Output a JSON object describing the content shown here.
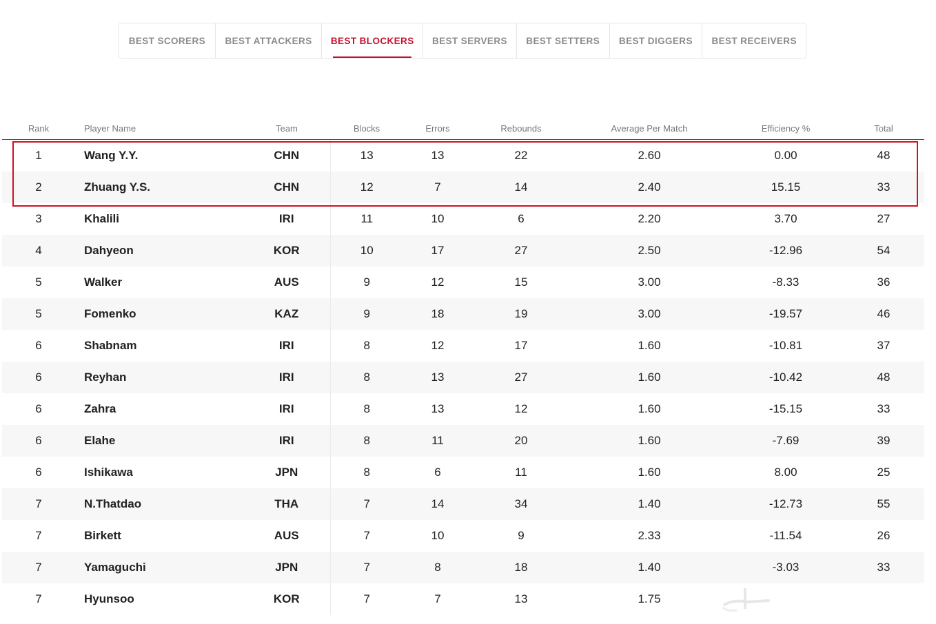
{
  "tabs": [
    {
      "label": "BEST SCORERS",
      "active": false
    },
    {
      "label": "BEST ATTACKERS",
      "active": false
    },
    {
      "label": "BEST BLOCKERS",
      "active": true
    },
    {
      "label": "BEST SERVERS",
      "active": false
    },
    {
      "label": "BEST SETTERS",
      "active": false
    },
    {
      "label": "BEST DIGGERS",
      "active": false
    },
    {
      "label": "BEST RECEIVERS",
      "active": false
    }
  ],
  "table": {
    "headers": {
      "rank": "Rank",
      "player": "Player Name",
      "team": "Team",
      "blocks": "Blocks",
      "errors": "Errors",
      "rebounds": "Rebounds",
      "avg": "Average Per Match",
      "efficiency": "Efficiency %",
      "total": "Total"
    },
    "rows": [
      {
        "rank": "1",
        "player": "Wang Y.Y.",
        "team": "CHN",
        "blocks": "13",
        "errors": "13",
        "rebounds": "22",
        "avg": "2.60",
        "efficiency": "0.00",
        "total": "48"
      },
      {
        "rank": "2",
        "player": "Zhuang Y.S.",
        "team": "CHN",
        "blocks": "12",
        "errors": "7",
        "rebounds": "14",
        "avg": "2.40",
        "efficiency": "15.15",
        "total": "33"
      },
      {
        "rank": "3",
        "player": "Khalili",
        "team": "IRI",
        "blocks": "11",
        "errors": "10",
        "rebounds": "6",
        "avg": "2.20",
        "efficiency": "3.70",
        "total": "27"
      },
      {
        "rank": "4",
        "player": "Dahyeon",
        "team": "KOR",
        "blocks": "10",
        "errors": "17",
        "rebounds": "27",
        "avg": "2.50",
        "efficiency": "-12.96",
        "total": "54"
      },
      {
        "rank": "5",
        "player": "Walker",
        "team": "AUS",
        "blocks": "9",
        "errors": "12",
        "rebounds": "15",
        "avg": "3.00",
        "efficiency": "-8.33",
        "total": "36"
      },
      {
        "rank": "5",
        "player": "Fomenko",
        "team": "KAZ",
        "blocks": "9",
        "errors": "18",
        "rebounds": "19",
        "avg": "3.00",
        "efficiency": "-19.57",
        "total": "46"
      },
      {
        "rank": "6",
        "player": "Shabnam",
        "team": "IRI",
        "blocks": "8",
        "errors": "12",
        "rebounds": "17",
        "avg": "1.60",
        "efficiency": "-10.81",
        "total": "37"
      },
      {
        "rank": "6",
        "player": "Reyhan",
        "team": "IRI",
        "blocks": "8",
        "errors": "13",
        "rebounds": "27",
        "avg": "1.60",
        "efficiency": "-10.42",
        "total": "48"
      },
      {
        "rank": "6",
        "player": "Zahra",
        "team": "IRI",
        "blocks": "8",
        "errors": "13",
        "rebounds": "12",
        "avg": "1.60",
        "efficiency": "-15.15",
        "total": "33"
      },
      {
        "rank": "6",
        "player": "Elahe",
        "team": "IRI",
        "blocks": "8",
        "errors": "11",
        "rebounds": "20",
        "avg": "1.60",
        "efficiency": "-7.69",
        "total": "39"
      },
      {
        "rank": "6",
        "player": "Ishikawa",
        "team": "JPN",
        "blocks": "8",
        "errors": "6",
        "rebounds": "11",
        "avg": "1.60",
        "efficiency": "8.00",
        "total": "25"
      },
      {
        "rank": "7",
        "player": "N.Thatdao",
        "team": "THA",
        "blocks": "7",
        "errors": "14",
        "rebounds": "34",
        "avg": "1.40",
        "efficiency": "-12.73",
        "total": "55"
      },
      {
        "rank": "7",
        "player": "Birkett",
        "team": "AUS",
        "blocks": "7",
        "errors": "10",
        "rebounds": "9",
        "avg": "2.33",
        "efficiency": "-11.54",
        "total": "26"
      },
      {
        "rank": "7",
        "player": "Yamaguchi",
        "team": "JPN",
        "blocks": "7",
        "errors": "8",
        "rebounds": "18",
        "avg": "1.40",
        "efficiency": "-3.03",
        "total": "33"
      },
      {
        "rank": "7",
        "player": "Hyunsoo",
        "team": "KOR",
        "blocks": "7",
        "errors": "7",
        "rebounds": "13",
        "avg": "1.75",
        "efficiency": "",
        "total": ""
      }
    ]
  },
  "colors": {
    "accent": "#c8102e",
    "highlight_box": "#d0101e",
    "tab_inactive": "#8a8a8a",
    "row_alt": "#f7f7f7"
  }
}
